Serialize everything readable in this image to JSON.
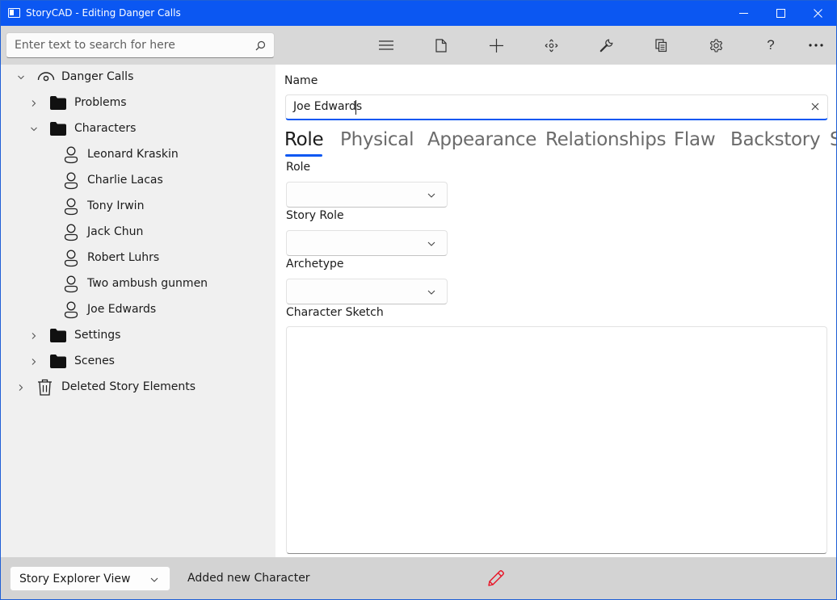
{
  "window": {
    "title": "StoryCAD - Editing Danger Calls",
    "controls": [
      "minimize-icon",
      "maximize-icon",
      "close-icon"
    ]
  },
  "search": {
    "placeholder": "Enter text to search for here",
    "icon": "search-icon"
  },
  "toolbar": {
    "buttons": [
      "hamburger-menu-icon",
      "new-file-icon",
      "add-icon",
      "move-arrows-icon",
      "wrench-icon",
      "copy-pages-icon",
      "gear-icon",
      "help-icon",
      "more-icon"
    ],
    "help_label": "?"
  },
  "tree": {
    "root": {
      "label": "Danger Calls",
      "icon": "eye-icon",
      "expanded": true
    },
    "items": [
      {
        "label": "Problems",
        "icon": "folder-icon",
        "expanded": false
      },
      {
        "label": "Characters",
        "icon": "folder-icon",
        "expanded": true,
        "children": [
          "Leonard Kraskin",
          "Charlie Lacas",
          "Tony Irwin",
          "Jack Chun",
          "Robert Luhrs",
          "Two ambush gunmen",
          "Joe Edwards"
        ]
      },
      {
        "label": "Settings",
        "icon": "folder-icon",
        "expanded": false
      },
      {
        "label": "Scenes",
        "icon": "folder-icon",
        "expanded": false
      }
    ],
    "trash": {
      "label": "Deleted Story Elements",
      "icon": "trash-icon",
      "expanded": false
    }
  },
  "content": {
    "name_label": "Name",
    "name_value": "Joe Edwards",
    "tabs": [
      "Role",
      "Physical",
      "Appearance",
      "Relationships",
      "Flaw",
      "Backstory",
      "S"
    ],
    "selected_tab": "Role",
    "fields": {
      "role_label": "Role",
      "role_value": "",
      "story_role_label": "Story Role",
      "story_role_value": "",
      "archetype_label": "Archetype",
      "archetype_value": "",
      "sketch_label": "Character Sketch",
      "sketch_value": ""
    }
  },
  "status": {
    "view": "Story Explorer View",
    "message": "Added new Character",
    "edit_icon_color": "#e81123"
  },
  "colors": {
    "accent": "#0b57f2",
    "toolbar_bg": "#d8d8d8",
    "sidebar_bg": "#f0f0f0"
  }
}
